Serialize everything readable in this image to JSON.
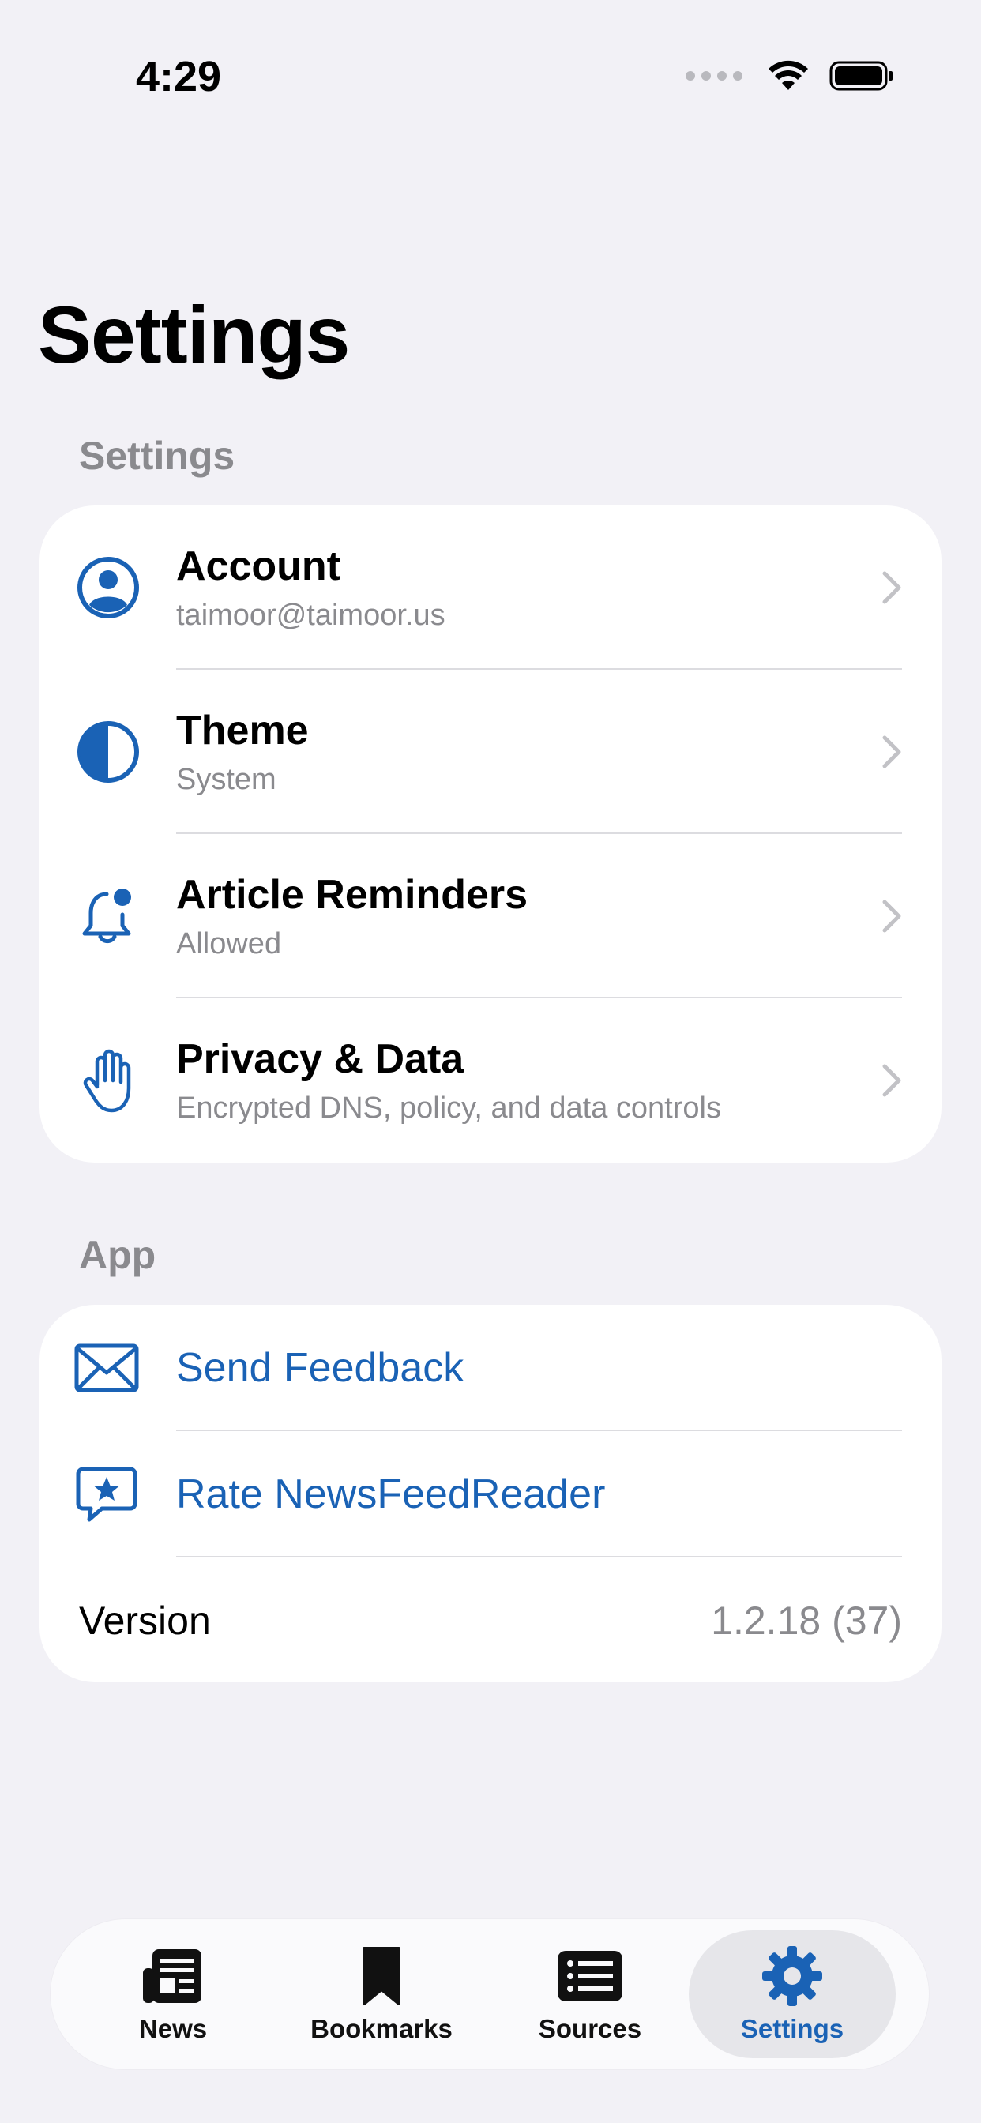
{
  "status_bar": {
    "time": "4:29"
  },
  "page": {
    "large_title": "Settings"
  },
  "sections": {
    "settings": {
      "header": "Settings",
      "rows": [
        {
          "title": "Account",
          "subtitle": "taimoor@taimoor.us",
          "icon": "person-circle-icon"
        },
        {
          "title": "Theme",
          "subtitle": "System",
          "icon": "half-circle-icon"
        },
        {
          "title": "Article Reminders",
          "subtitle": "Allowed",
          "icon": "bell-badge-icon"
        },
        {
          "title": "Privacy & Data",
          "subtitle": "Encrypted DNS, policy, and data controls",
          "icon": "hand-raised-icon"
        }
      ]
    },
    "app": {
      "header": "App",
      "send_feedback": "Send Feedback",
      "rate_app": "Rate NewsFeedReader",
      "version_label": "Version",
      "version_value": "1.2.18 (37)"
    }
  },
  "tab_bar": {
    "tabs": [
      {
        "label": "News",
        "icon": "newspaper-icon"
      },
      {
        "label": "Bookmarks",
        "icon": "bookmark-icon"
      },
      {
        "label": "Sources",
        "icon": "list-icon"
      },
      {
        "label": "Settings",
        "icon": "gear-icon",
        "active": true
      }
    ]
  },
  "colors": {
    "accent": "#1a62b5",
    "background": "#f2f1f6",
    "secondary_text": "#8a8a8e"
  }
}
